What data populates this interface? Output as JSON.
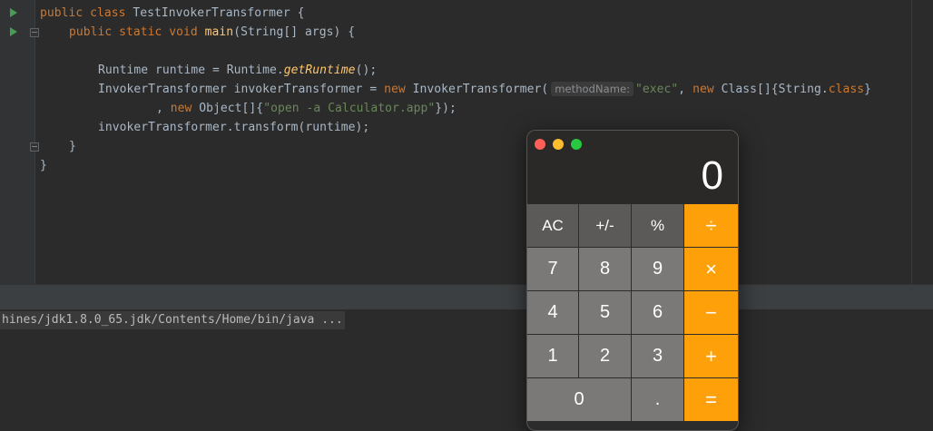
{
  "editor": {
    "line1": {
      "kw": "public class ",
      "name": "TestInvokerTransformer",
      "rest": " {"
    },
    "line2": {
      "kw": "public static void ",
      "fn": "main",
      "rest": "(String[] args) {"
    },
    "line4": {
      "a": "Runtime runtime = Runtime.",
      "it": "getRuntime",
      "b": "();"
    },
    "line5": {
      "a": "InvokerTransformer invokerTransformer = ",
      "kw1": "new",
      "b": " InvokerTransformer(",
      "hint": "methodName:",
      "str": "\"exec\"",
      "c": ", ",
      "kw2": "new",
      "d": " Class[]{String.",
      "kw3": "class",
      "e": "}"
    },
    "line6": {
      "a": ", ",
      "kw": "new",
      "b": " Object[]{",
      "str": "\"open -a Calculator.app\"",
      "c": "});"
    },
    "line7": {
      "a": "invokerTransformer.transform(runtime);"
    },
    "line8": {
      "a": "}"
    },
    "line9": {
      "a": "}"
    }
  },
  "console": {
    "text": "hines/jdk1.8.0_65.jdk/Contents/Home/bin/java ..."
  },
  "calculator": {
    "display": "0",
    "keys": {
      "ac": "AC",
      "sign": "+/-",
      "percent": "%",
      "divide": "÷",
      "seven": "7",
      "eight": "8",
      "nine": "9",
      "multiply": "×",
      "four": "4",
      "five": "5",
      "six": "6",
      "minus": "−",
      "one": "1",
      "two": "2",
      "three": "3",
      "plus": "+",
      "zero": "0",
      "decimal": ".",
      "equals": "="
    }
  },
  "colors": {
    "keyword": "#cc7832",
    "function": "#ffc66d",
    "string": "#6a8759",
    "operator_key": "#fea00a"
  }
}
